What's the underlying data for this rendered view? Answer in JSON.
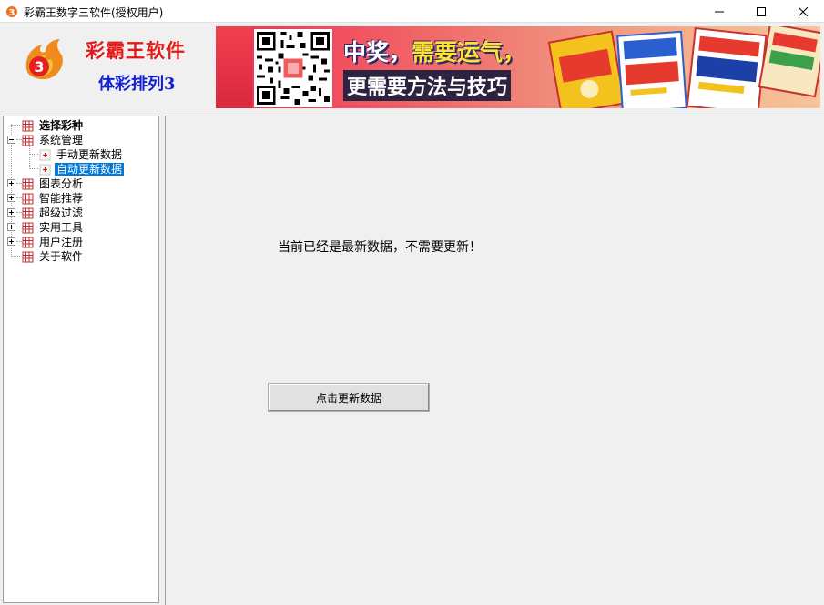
{
  "window": {
    "title": "彩霸王数字三软件(授权用户)"
  },
  "header": {
    "brand_name": "彩霸王软件",
    "product_name": "体彩排列3",
    "banner": {
      "slogan_line1_a": "中奖，",
      "slogan_line1_b": "需要运气，",
      "slogan_line2": "更需要方法与技巧"
    }
  },
  "tree": {
    "items": [
      {
        "label": "选择彩种",
        "bold": true
      },
      {
        "label": "系统管理"
      },
      {
        "label": "手动更新数据"
      },
      {
        "label": "自动更新数据",
        "selected": true
      },
      {
        "label": "图表分析"
      },
      {
        "label": "智能推荐"
      },
      {
        "label": "超级过滤"
      },
      {
        "label": "实用工具"
      },
      {
        "label": "用户注册"
      },
      {
        "label": "关于软件"
      }
    ]
  },
  "content": {
    "status_message": "当前已经是最新数据，不需要更新！",
    "update_button_label": "点击更新数据"
  },
  "colors": {
    "brand_red": "#e41a1a",
    "product_blue": "#1220d4",
    "selection_blue": "#0078d7"
  }
}
